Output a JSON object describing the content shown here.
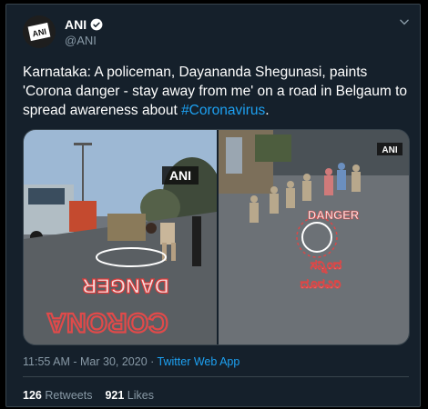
{
  "author": {
    "name": "ANI",
    "handle": "@ANI",
    "avatar_text": "ANI"
  },
  "tweet": {
    "text_before": "Karnataka: A policeman, Dayananda Shegunasi, paints 'Corona danger - stay away from me' on a road in Belgaum to spread awareness about ",
    "hashtag": "#Coronavirus",
    "text_after": "."
  },
  "media": {
    "left_watermark": "ANI",
    "right_watermark": "ANI",
    "left_road_text_1": "DANGER",
    "left_road_text_2": "CORONA",
    "right_road_text_1": "DANGER",
    "right_road_text_2": "ಸನ್ನಿಂದ",
    "right_road_text_3": "ದೂರವಿರಿ"
  },
  "meta": {
    "time_date": "11:55 AM - Mar 30, 2020",
    "separator": " · ",
    "source": "Twitter Web App"
  },
  "stats": {
    "retweets_count": "126",
    "retweets_label": "Retweets",
    "likes_count": "921",
    "likes_label": "Likes"
  },
  "colors": {
    "background": "#15202b",
    "accent": "#1da1f2",
    "muted": "#8899a6"
  }
}
